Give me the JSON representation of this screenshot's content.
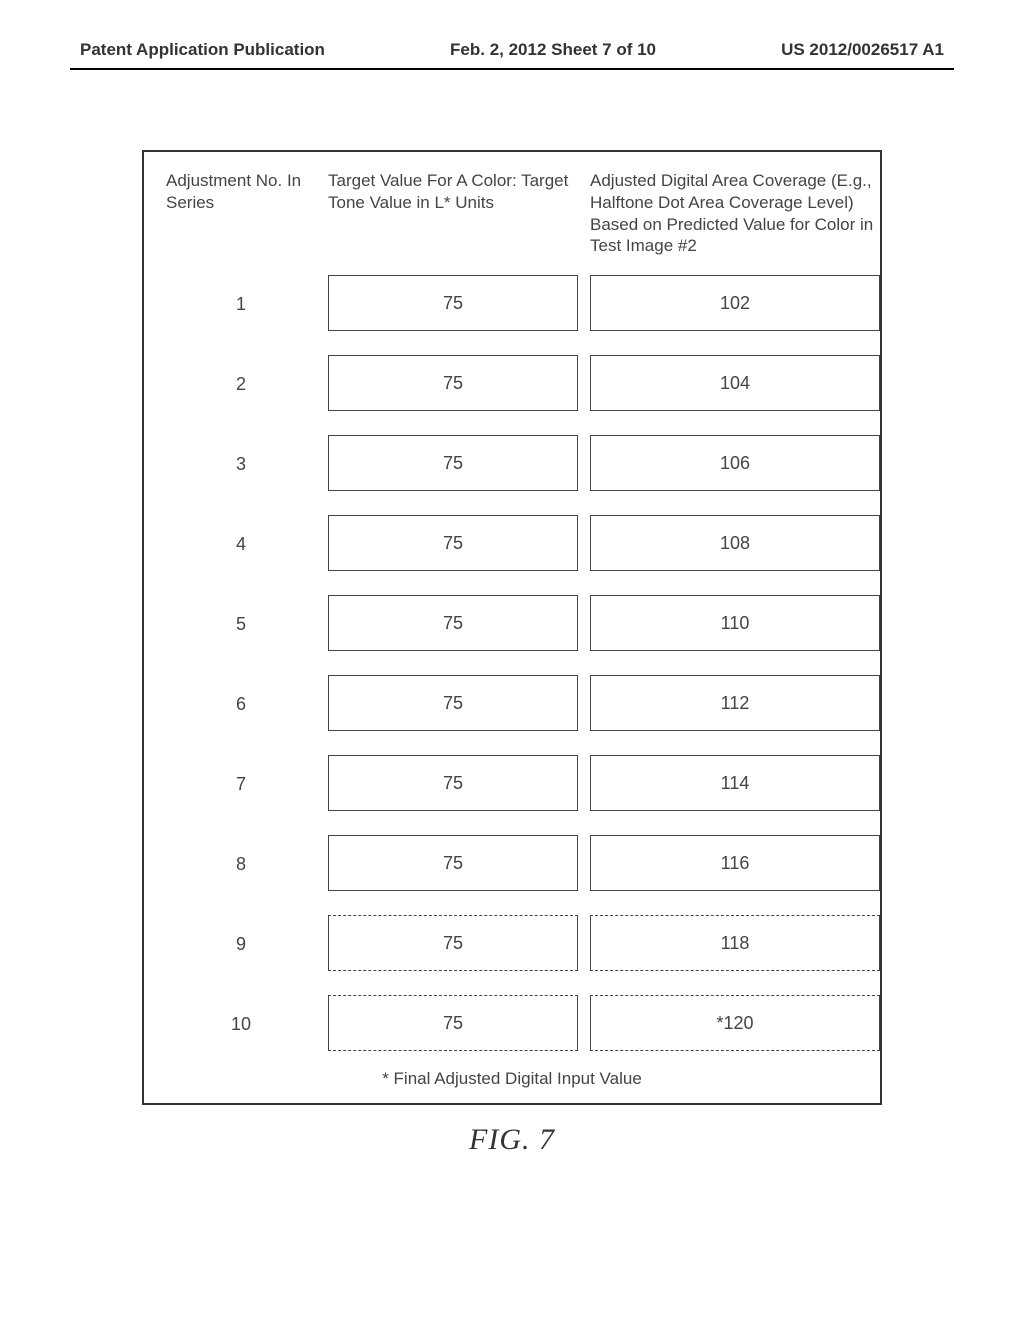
{
  "header": {
    "left": "Patent Application Publication",
    "center": "Feb. 2, 2012  Sheet 7 of 10",
    "right": "US 2012/0026517 A1"
  },
  "table": {
    "col1_header": "Adjustment No. In Series",
    "col2_header": "Target Value For A Color: Target Tone Value in L* Units",
    "col3_header": "Adjusted Digital Area Coverage (E.g., Halftone Dot Area Coverage Level) Based on Predicted Value for Color in Test Image #2",
    "rows": [
      {
        "n": "1",
        "target": "75",
        "adjusted": "102"
      },
      {
        "n": "2",
        "target": "75",
        "adjusted": "104"
      },
      {
        "n": "3",
        "target": "75",
        "adjusted": "106"
      },
      {
        "n": "4",
        "target": "75",
        "adjusted": "108"
      },
      {
        "n": "5",
        "target": "75",
        "adjusted": "110"
      },
      {
        "n": "6",
        "target": "75",
        "adjusted": "112"
      },
      {
        "n": "7",
        "target": "75",
        "adjusted": "114"
      },
      {
        "n": "8",
        "target": "75",
        "adjusted": "116"
      },
      {
        "n": "9",
        "target": "75",
        "adjusted": "118"
      },
      {
        "n": "10",
        "target": "75",
        "adjusted": "*120"
      }
    ],
    "footnote": "* Final Adjusted Digital Input Value"
  },
  "caption": "FIG. 7"
}
